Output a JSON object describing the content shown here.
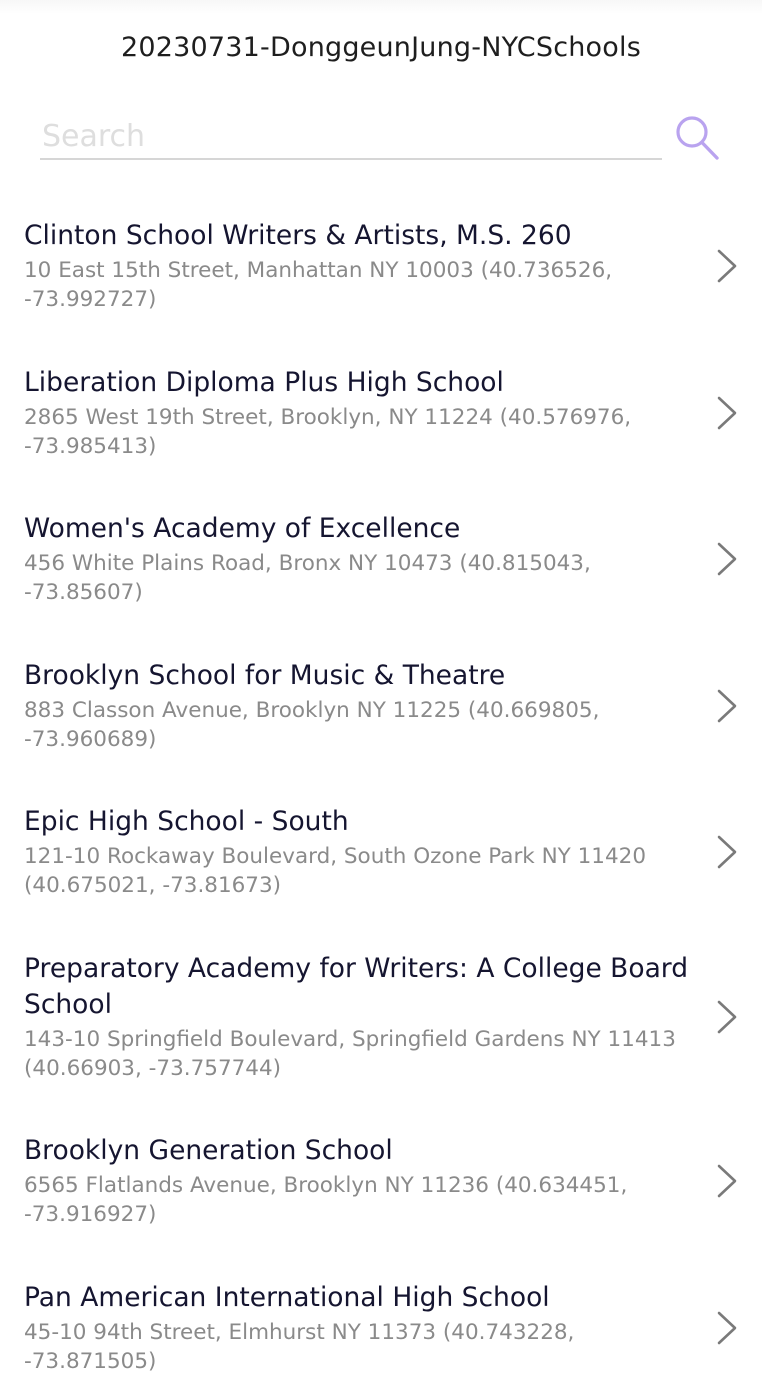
{
  "app": {
    "title": "20230731-DonggeunJung-NYCSchools"
  },
  "search": {
    "placeholder": "Search",
    "value": "",
    "accent_color": "#b9a3ef"
  },
  "schools": [
    {
      "name": "Clinton School Writers & Artists, M.S. 260",
      "address": "10 East 15th Street, Manhattan NY 10003 (40.736526, -73.992727)"
    },
    {
      "name": "Liberation Diploma Plus High School",
      "address": "2865 West 19th Street, Brooklyn, NY 11224 (40.576976, -73.985413)"
    },
    {
      "name": "Women's Academy of Excellence",
      "address": "456 White Plains Road, Bronx NY 10473 (40.815043, -73.85607)"
    },
    {
      "name": "Brooklyn School for Music & Theatre",
      "address": "883 Classon Avenue, Brooklyn NY 11225 (40.669805, -73.960689)"
    },
    {
      "name": "Epic High School - South",
      "address": "121-10 Rockaway Boulevard, South Ozone Park NY 11420 (40.675021, -73.81673)"
    },
    {
      "name": "Preparatory Academy for Writers: A College Board School",
      "address": "143-10 Springfield Boulevard, Springfield Gardens NY 11413 (40.66903, -73.757744)"
    },
    {
      "name": "Brooklyn Generation School",
      "address": "6565 Flatlands Avenue, Brooklyn NY 11236 (40.634451, -73.916927)"
    },
    {
      "name": "Pan American International High School",
      "address": "45-10 94th Street, Elmhurst NY 11373 (40.743228, -73.871505)"
    }
  ],
  "icons": {
    "search": "search-icon",
    "row_disclosure": "chevron-right-icon"
  }
}
